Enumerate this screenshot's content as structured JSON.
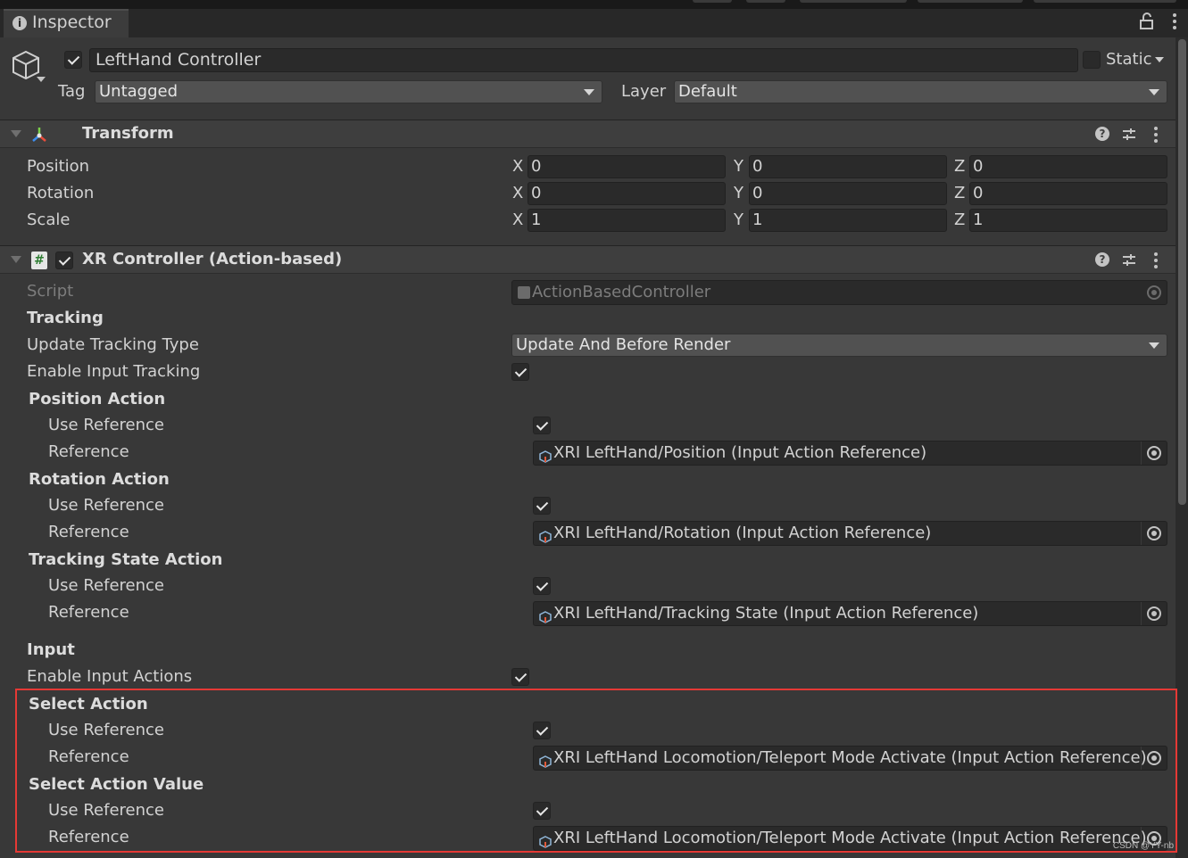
{
  "tab": {
    "title": "Inspector"
  },
  "header": {
    "object_name": "LeftHand Controller",
    "active": true,
    "static_label": "Static",
    "static": false,
    "tag_label": "Tag",
    "tag_value": "Untagged",
    "layer_label": "Layer",
    "layer_value": "Default"
  },
  "transform": {
    "title": "Transform",
    "rows": [
      {
        "label": "Position",
        "x": "0",
        "y": "0",
        "z": "0"
      },
      {
        "label": "Rotation",
        "x": "0",
        "y": "0",
        "z": "0"
      },
      {
        "label": "Scale",
        "x": "1",
        "y": "1",
        "z": "1"
      }
    ],
    "axes": {
      "x": "X",
      "y": "Y",
      "z": "Z"
    }
  },
  "xr": {
    "title": "XR Controller (Action-based)",
    "enabled": true,
    "script_label": "Script",
    "script_value": "ActionBasedController",
    "tracking_header": "Tracking",
    "update_tracking_type_label": "Update Tracking Type",
    "update_tracking_type_value": "Update And Before Render",
    "enable_input_tracking_label": "Enable Input Tracking",
    "enable_input_tracking": true,
    "input_header": "Input",
    "enable_input_actions_label": "Enable Input Actions",
    "enable_input_actions": true,
    "actions": [
      {
        "header": "Position Action",
        "use_label": "Use Reference",
        "use": true,
        "ref_label": "Reference",
        "ref_value": "XRI LeftHand/Position (Input Action Reference)"
      },
      {
        "header": "Rotation Action",
        "use_label": "Use Reference",
        "use": true,
        "ref_label": "Reference",
        "ref_value": "XRI LeftHand/Rotation (Input Action Reference)"
      },
      {
        "header": "Tracking State Action",
        "use_label": "Use Reference",
        "use": true,
        "ref_label": "Reference",
        "ref_value": "XRI LeftHand/Tracking State (Input Action Reference)"
      },
      {
        "header": "Select Action",
        "use_label": "Use Reference",
        "use": true,
        "ref_label": "Reference",
        "ref_value": "XRI LeftHand Locomotion/Teleport Mode Activate (Input Action Reference)"
      },
      {
        "header": "Select Action Value",
        "use_label": "Use Reference",
        "use": true,
        "ref_label": "Reference",
        "ref_value": "XRI LeftHand Locomotion/Teleport Mode Activate (Input Action Reference)"
      }
    ]
  },
  "highlight_color": "#e53935",
  "watermark": "CSDN @YY-nb"
}
